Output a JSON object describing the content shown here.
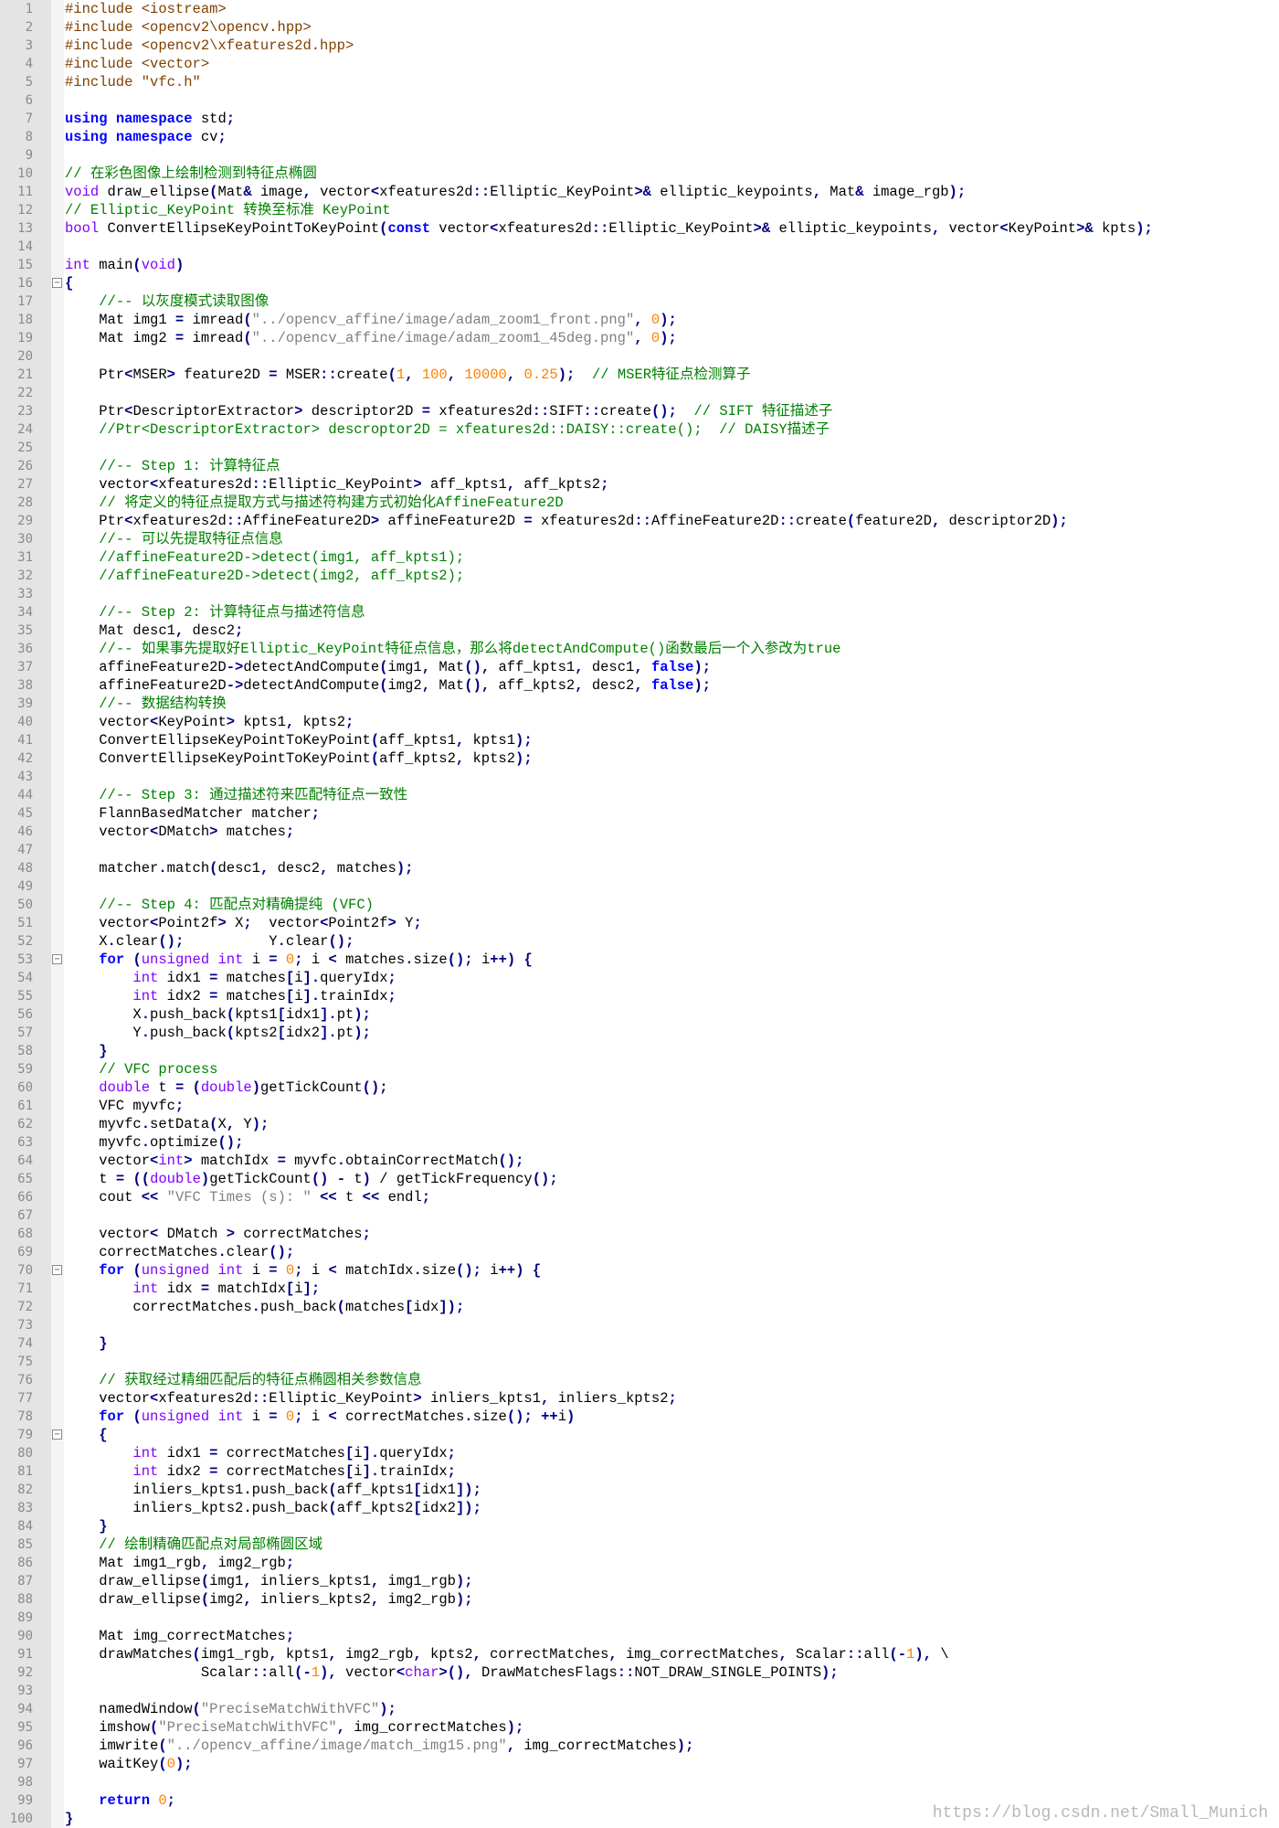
{
  "editor": {
    "lines": [
      "#include <iostream>",
      "#include <opencv2\\opencv.hpp>",
      "#include <opencv2\\xfeatures2d.hpp>",
      "#include <vector>",
      "#include \"vfc.h\"",
      "",
      "using namespace std;",
      "using namespace cv;",
      "",
      "// 在彩色图像上绘制检测到特征点椭圆",
      "void draw_ellipse(Mat& image, vector<xfeatures2d::Elliptic_KeyPoint>& elliptic_keypoints, Mat& image_rgb);",
      "// Elliptic_KeyPoint 转换至标准 KeyPoint",
      "bool ConvertEllipseKeyPointToKeyPoint(const vector<xfeatures2d::Elliptic_KeyPoint>& elliptic_keypoints, vector<KeyPoint>& kpts);",
      "",
      "int main(void)",
      "{",
      "    //-- 以灰度模式读取图像",
      "    Mat img1 = imread(\"../opencv_affine/image/adam_zoom1_front.png\", 0);",
      "    Mat img2 = imread(\"../opencv_affine/image/adam_zoom1_45deg.png\", 0);",
      "",
      "    Ptr<MSER> feature2D = MSER::create(1, 100, 10000, 0.25);  // MSER特征点检测算子",
      "",
      "    Ptr<DescriptorExtractor> descriptor2D = xfeatures2d::SIFT::create();  // SIFT 特征描述子",
      "    //Ptr<DescriptorExtractor> descroptor2D = xfeatures2d::DAISY::create();  // DAISY描述子",
      "",
      "    //-- Step 1: 计算特征点",
      "    vector<xfeatures2d::Elliptic_KeyPoint> aff_kpts1, aff_kpts2;",
      "    // 将定义的特征点提取方式与描述符构建方式初始化AffineFeature2D",
      "    Ptr<xfeatures2d::AffineFeature2D> affineFeature2D = xfeatures2d::AffineFeature2D::create(feature2D, descriptor2D);",
      "    //-- 可以先提取特征点信息",
      "    //affineFeature2D->detect(img1, aff_kpts1);",
      "    //affineFeature2D->detect(img2, aff_kpts2);",
      "",
      "    //-- Step 2: 计算特征点与描述符信息",
      "    Mat desc1, desc2;",
      "    //-- 如果事先提取好Elliptic_KeyPoint特征点信息，那么将detectAndCompute()函数最后一个入参改为true",
      "    affineFeature2D->detectAndCompute(img1, Mat(), aff_kpts1, desc1, false);",
      "    affineFeature2D->detectAndCompute(img2, Mat(), aff_kpts2, desc2, false);",
      "    //-- 数据结构转换",
      "    vector<KeyPoint> kpts1, kpts2;",
      "    ConvertEllipseKeyPointToKeyPoint(aff_kpts1, kpts1);",
      "    ConvertEllipseKeyPointToKeyPoint(aff_kpts2, kpts2);",
      "",
      "    //-- Step 3: 通过描述符来匹配特征点一致性",
      "    FlannBasedMatcher matcher;",
      "    vector<DMatch> matches;",
      "",
      "    matcher.match(desc1, desc2, matches);",
      "",
      "    //-- Step 4: 匹配点对精确提纯 (VFC)",
      "    vector<Point2f> X;  vector<Point2f> Y;",
      "    X.clear();          Y.clear();",
      "    for (unsigned int i = 0; i < matches.size(); i++) {",
      "        int idx1 = matches[i].queryIdx;",
      "        int idx2 = matches[i].trainIdx;",
      "        X.push_back(kpts1[idx1].pt);",
      "        Y.push_back(kpts2[idx2].pt);",
      "    }",
      "    // VFC process",
      "    double t = (double)getTickCount();",
      "    VFC myvfc;",
      "    myvfc.setData(X, Y);",
      "    myvfc.optimize();",
      "    vector<int> matchIdx = myvfc.obtainCorrectMatch();",
      "    t = ((double)getTickCount() - t) / getTickFrequency();",
      "    cout << \"VFC Times (s): \" << t << endl;",
      "",
      "    vector< DMatch > correctMatches;",
      "    correctMatches.clear();",
      "    for (unsigned int i = 0; i < matchIdx.size(); i++) {",
      "        int idx = matchIdx[i];",
      "        correctMatches.push_back(matches[idx]);",
      "",
      "    }",
      "",
      "    // 获取经过精细匹配后的特征点椭圆相关参数信息",
      "    vector<xfeatures2d::Elliptic_KeyPoint> inliers_kpts1, inliers_kpts2;",
      "    for (unsigned int i = 0; i < correctMatches.size(); ++i)",
      "    {",
      "        int idx1 = correctMatches[i].queryIdx;",
      "        int idx2 = correctMatches[i].trainIdx;",
      "        inliers_kpts1.push_back(aff_kpts1[idx1]);",
      "        inliers_kpts2.push_back(aff_kpts2[idx2]);",
      "    }",
      "    // 绘制精确匹配点对局部椭圆区域",
      "    Mat img1_rgb, img2_rgb;",
      "    draw_ellipse(img1, inliers_kpts1, img1_rgb);",
      "    draw_ellipse(img2, inliers_kpts2, img2_rgb);",
      "",
      "    Mat img_correctMatches;",
      "    drawMatches(img1_rgb, kpts1, img2_rgb, kpts2, correctMatches, img_correctMatches, Scalar::all(-1), \\",
      "                Scalar::all(-1), vector<char>(), DrawMatchesFlags::NOT_DRAW_SINGLE_POINTS);",
      "",
      "    namedWindow(\"PreciseMatchWithVFC\");",
      "    imshow(\"PreciseMatchWithVFC\", img_correctMatches);",
      "    imwrite(\"../opencv_affine/image/match_img15.png\", img_correctMatches);",
      "    waitKey(0);",
      "",
      "    return 0;",
      "}"
    ],
    "fold_lines": [
      16,
      53,
      70,
      79
    ],
    "watermark": "https://blog.csdn.net/Small_Munich",
    "colors": {
      "keyword": "#0000ff",
      "type": "#8000ff",
      "number": "#ff8000",
      "string": "#808080",
      "comment": "#008000",
      "preprocessor": "#804000",
      "operator": "#000080"
    }
  }
}
